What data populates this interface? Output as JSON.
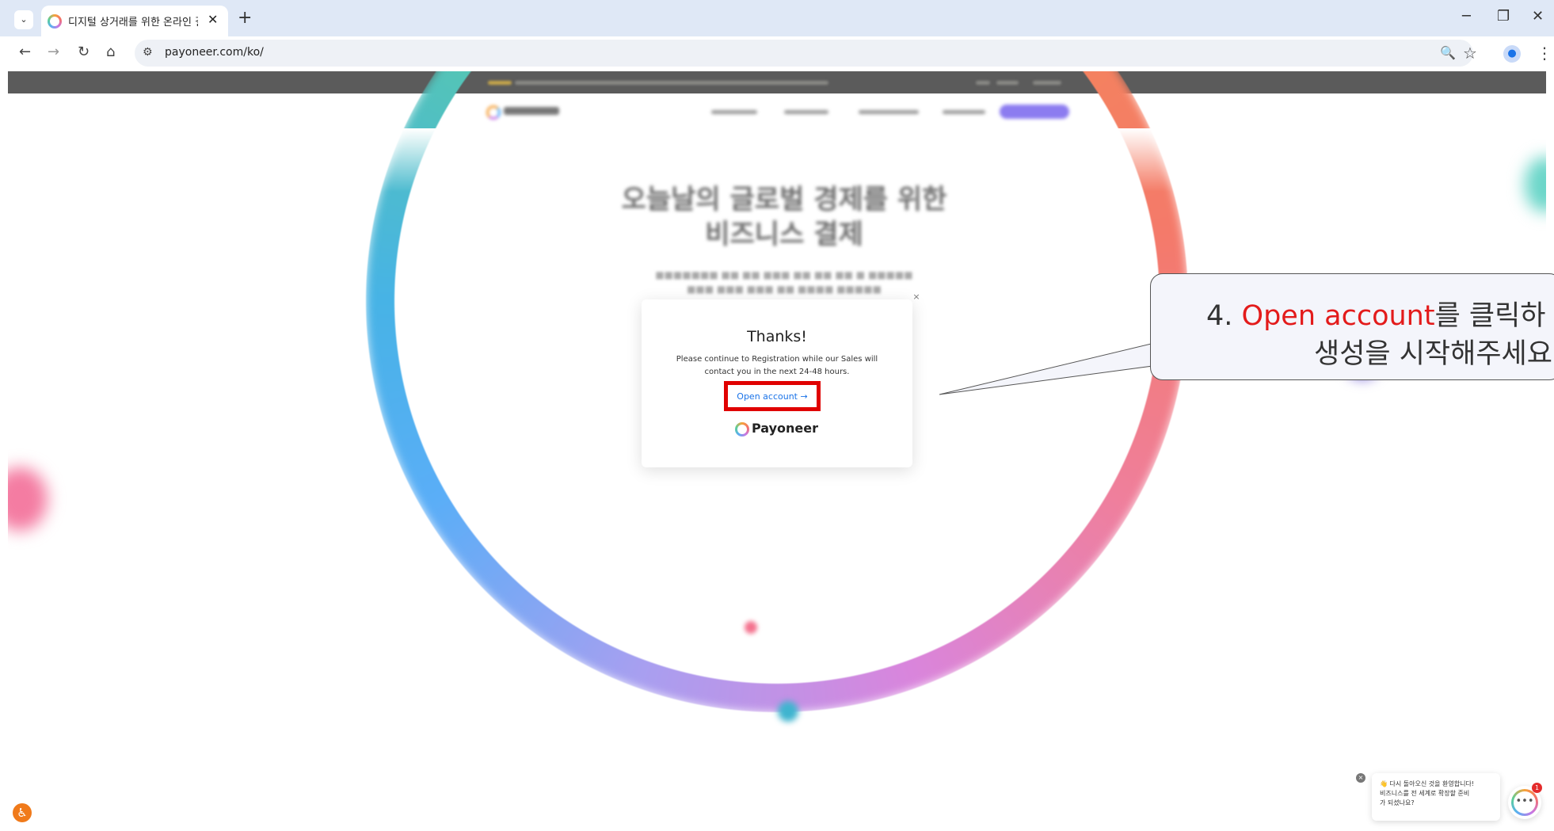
{
  "browser": {
    "tab_title": "디지털 상거래를 위한 온라인 결",
    "tab_close": "✕",
    "new_tab": "+",
    "tab_menu": "⌄",
    "url": "payoneer.com/ko/",
    "window_min": "─",
    "window_restore": "❐",
    "window_close": "✕",
    "back": "←",
    "forward": "→",
    "reload": "↻",
    "home": "⌂",
    "site_info": "⚙",
    "zoom": "🔍",
    "bookmark": "☆",
    "menu": "⋮"
  },
  "modal": {
    "close": "×",
    "title": "Thanks!",
    "message": "Please continue to Registration while our Sales will contact you in the next 24-48 hours.",
    "cta": "Open account →",
    "logo": "Payoneer"
  },
  "callout": {
    "number": "4. ",
    "highlight": "Open account",
    "line1_rest": "를 클릭하",
    "line2": "생성을 시작해주세요"
  },
  "chat": {
    "close": "×",
    "line1": "👋 다시 돌아오신 것을 환영합니다!",
    "line2": "비즈니스를 전 세계로 확장할 준비",
    "line3": "가 되셨나요?",
    "badge": "1"
  },
  "accessibility": "♿"
}
